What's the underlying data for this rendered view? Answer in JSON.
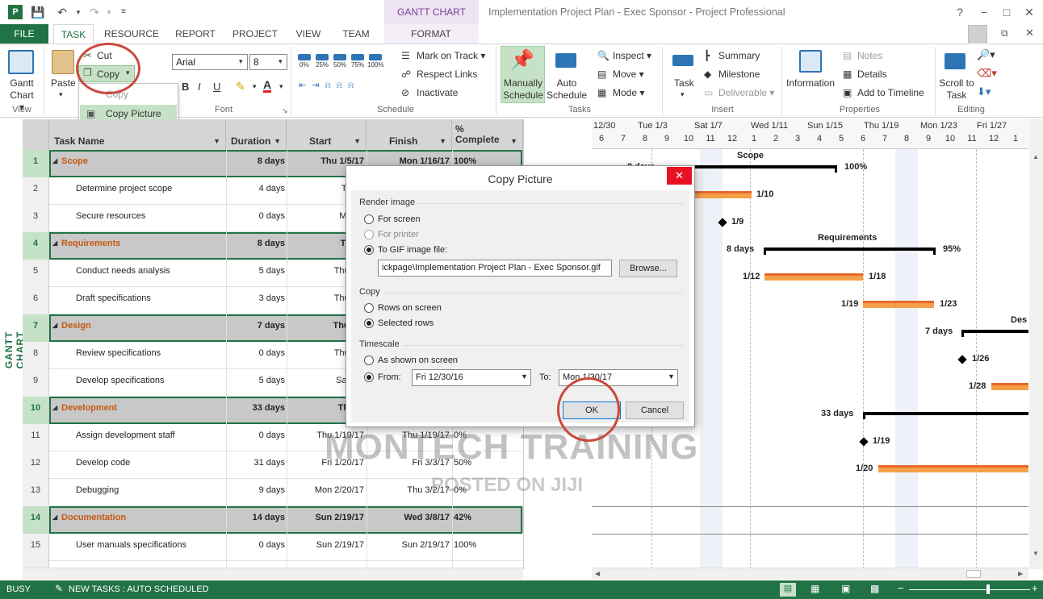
{
  "window": {
    "title": "Implementation Project Plan - Exec Sponsor - Project Professional",
    "contextual_tab_group": "GANTT CHART TOOLS",
    "controls": [
      "?",
      "−",
      "□",
      "✕"
    ]
  },
  "tabs": [
    {
      "label": "FILE"
    },
    {
      "label": "TASK"
    },
    {
      "label": "RESOURCE"
    },
    {
      "label": "REPORT"
    },
    {
      "label": "PROJECT"
    },
    {
      "label": "VIEW"
    },
    {
      "label": "TEAM"
    },
    {
      "label": "FORMAT"
    }
  ],
  "ribbon": {
    "view": {
      "gantt_chart": "Gantt Chart",
      "group": "View"
    },
    "clipboard": {
      "paste": "Paste",
      "cut": "Cut",
      "copy": "Copy",
      "menu_copy": "Copy",
      "menu_copy_picture": "Copy Picture"
    },
    "font": {
      "name": "Arial",
      "size": "8",
      "group": "Font",
      "bold": "B",
      "italic": "I",
      "underline": "U"
    },
    "schedule": {
      "percents": [
        "0%",
        "25%",
        "50%",
        "75%",
        "100%"
      ],
      "mark_on_track": "Mark on Track",
      "respect_links": "Respect Links",
      "inactivate": "Inactivate",
      "group": "Schedule"
    },
    "tasks": {
      "manually_schedule": "Manually Schedule",
      "auto_schedule": "Auto Schedule",
      "inspect": "Inspect",
      "move": "Move",
      "mode": "Mode",
      "group": "Tasks"
    },
    "insert": {
      "task": "Task",
      "summary": "Summary",
      "milestone": "Milestone",
      "deliverable": "Deliverable",
      "group": "Insert"
    },
    "properties": {
      "information": "Information",
      "notes": "Notes",
      "details": "Details",
      "add_to_timeline": "Add to Timeline",
      "group": "Properties"
    },
    "editing": {
      "scroll_to_task": "Scroll to Task",
      "group": "Editing"
    }
  },
  "side_label": "GANTT CHART",
  "grid": {
    "columns": [
      "Task Name",
      "Duration",
      "Start",
      "Finish",
      "% Complete"
    ],
    "rows": [
      {
        "id": "1",
        "name": "Scope",
        "duration": "8 days",
        "start": "Thu 1/5/17",
        "finish": "Mon 1/16/17",
        "pct": "100%",
        "summary": true
      },
      {
        "id": "2",
        "name": "Determine project scope",
        "duration": "4 days",
        "start": "Thu 1",
        "finish": "",
        "pct": "",
        "summary": false
      },
      {
        "id": "3",
        "name": "Secure resources",
        "duration": "0 days",
        "start": "Mon 1",
        "finish": "",
        "pct": "",
        "summary": false
      },
      {
        "id": "4",
        "name": "Requirements",
        "duration": "8 days",
        "start": "Thu 1",
        "finish": "",
        "pct": "",
        "summary": true
      },
      {
        "id": "5",
        "name": "Conduct needs analysis",
        "duration": "5 days",
        "start": "Thu 1/1",
        "finish": "",
        "pct": "",
        "summary": false
      },
      {
        "id": "6",
        "name": "Draft specifications",
        "duration": "3 days",
        "start": "Thu 1/1",
        "finish": "",
        "pct": "",
        "summary": false
      },
      {
        "id": "7",
        "name": "Design",
        "duration": "7 days",
        "start": "Thu 1/2",
        "finish": "",
        "pct": "",
        "summary": true
      },
      {
        "id": "8",
        "name": "Review specifications",
        "duration": "0 days",
        "start": "Thu 1/2",
        "finish": "",
        "pct": "",
        "summary": false
      },
      {
        "id": "9",
        "name": "Develop specifications",
        "duration": "5 days",
        "start": "Sat 1/2",
        "finish": "",
        "pct": "",
        "summary": false
      },
      {
        "id": "10",
        "name": "Development",
        "duration": "33 days",
        "start": "Thu 1/",
        "finish": "",
        "pct": "",
        "summary": true
      },
      {
        "id": "11",
        "name": "Assign development staff",
        "duration": "0 days",
        "start": "Thu 1/19/17",
        "finish": "Thu 1/19/17",
        "pct": "0%",
        "summary": false
      },
      {
        "id": "12",
        "name": "Develop code",
        "duration": "31 days",
        "start": "Fri 1/20/17",
        "finish": "Fri 3/3/17",
        "pct": "50%",
        "summary": false
      },
      {
        "id": "13",
        "name": "Debugging",
        "duration": "9 days",
        "start": "Mon 2/20/17",
        "finish": "Thu 3/2/17",
        "pct": "0%",
        "summary": false
      },
      {
        "id": "14",
        "name": "Documentation",
        "duration": "14 days",
        "start": "Sun 2/19/17",
        "finish": "Wed 3/8/17",
        "pct": "42%",
        "summary": true
      },
      {
        "id": "15",
        "name": "User manuals specifications",
        "duration": "0 days",
        "start": "Sun 2/19/17",
        "finish": "Sun 2/19/17",
        "pct": "100%",
        "summary": false
      },
      {
        "id": "16",
        "name": "Develop user manuals",
        "duration": "2 wks",
        "start": "Mon 2/20/17",
        "finish": "Fri 3/3/17",
        "pct": "50%",
        "summary": false
      }
    ]
  },
  "timescale": {
    "weeks": [
      "12/30",
      "Tue 1/3",
      "Sat 1/7",
      "Wed 1/11",
      "Sun 1/15",
      "Thu 1/19",
      "Mon 1/23",
      "Fri 1/27"
    ],
    "days": [
      "6",
      "7",
      "8",
      "9",
      "10",
      "11",
      "12",
      "1",
      "2",
      "3",
      "4",
      "5",
      "6",
      "7",
      "8",
      "9",
      "10",
      "11",
      "12",
      "1"
    ]
  },
  "gantt_labels": {
    "scope": "Scope",
    "scope_days": "8 days",
    "scope_pct": "100%",
    "t2_date": "1/10",
    "t3_date": "1/9",
    "req": "Requirements",
    "req_days": "8 days",
    "req_pct": "95%",
    "t5_start": "1/12",
    "t5_end": "1/18",
    "t6_start": "1/19",
    "t6_end": "1/23",
    "design": "Des",
    "design_days": "7 days",
    "t8_date": "1/26",
    "t9_start": "1/28",
    "dev_days": "33 days",
    "t11_date": "1/19",
    "t12_start": "1/20"
  },
  "dialog": {
    "title": "Copy Picture",
    "render_image": "Render image",
    "for_screen": "For screen",
    "for_printer": "For printer",
    "to_gif": "To GIF image file:",
    "gif_path": "ickpage\\Implementation Project Plan - Exec Sponsor.gif",
    "browse": "Browse...",
    "copy": "Copy",
    "rows_on_screen": "Rows on screen",
    "selected_rows": "Selected rows",
    "timescale": "Timescale",
    "as_shown": "As shown on screen",
    "from": "From:",
    "from_value": "Fri 12/30/16",
    "to": "To:",
    "to_value": "Mon 1/30/17",
    "ok": "OK",
    "cancel": "Cancel"
  },
  "status": {
    "busy": "BUSY",
    "new_tasks": "NEW TASKS : AUTO SCHEDULED"
  },
  "watermark": {
    "line1": "MONTECH TRAINING",
    "line2": "POSTED ON JIJI"
  }
}
